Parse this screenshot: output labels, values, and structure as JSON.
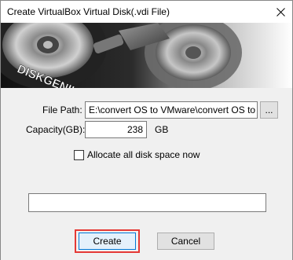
{
  "window": {
    "title": "Create VirtualBox Virtual Disk(.vdi File)"
  },
  "banner": {
    "brand_text": "DISKGENIUS"
  },
  "form": {
    "file_path_label": "File Path:",
    "file_path_value": "E:\\convert OS to VMware\\convert OS to",
    "browse_label": "...",
    "capacity_label": "Capacity(GB):",
    "capacity_value": "238",
    "capacity_unit": "GB",
    "allocate_label": "Allocate all disk space now",
    "allocate_checked": false,
    "progress_value": ""
  },
  "buttons": {
    "create_label": "Create",
    "cancel_label": "Cancel"
  },
  "colors": {
    "highlight": "#e53935",
    "banner_dark": "#1a1a1a"
  }
}
